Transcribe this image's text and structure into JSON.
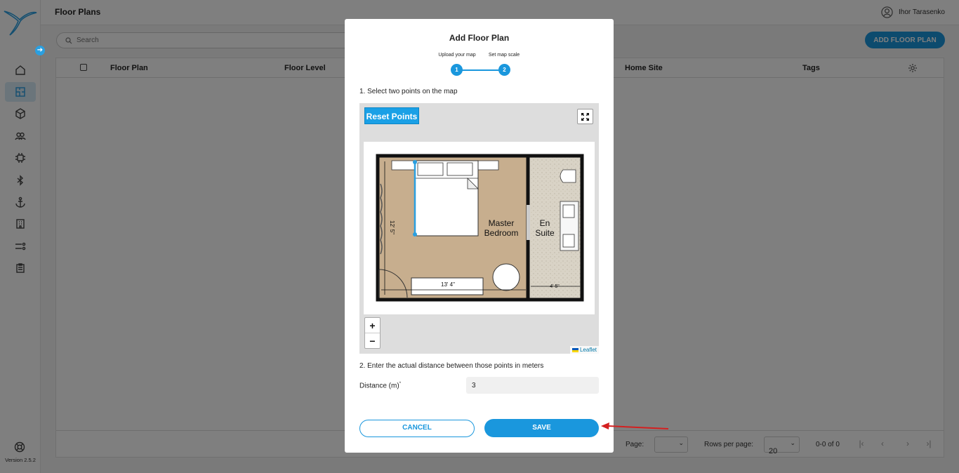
{
  "app": {
    "page_title": "Floor Plans",
    "user_name": "Ihor Tarasenko",
    "version": "Version 2.5.2",
    "accent_color": "#1a97dd"
  },
  "sidebar": {
    "items": [
      {
        "icon": "home-icon"
      },
      {
        "icon": "floor-plan-icon",
        "active": true
      },
      {
        "icon": "cube-icon"
      },
      {
        "icon": "users-icon"
      },
      {
        "icon": "chip-icon"
      },
      {
        "icon": "bluetooth-icon"
      },
      {
        "icon": "anchor-icon"
      },
      {
        "icon": "building-icon"
      },
      {
        "icon": "rules-icon"
      },
      {
        "icon": "report-icon"
      }
    ]
  },
  "toolbar": {
    "search_placeholder": "Search",
    "add_label": "ADD FLOOR PLAN"
  },
  "table": {
    "columns": [
      "Floor Plan",
      "Floor Level",
      "Home Site",
      "Tags"
    ],
    "footer": {
      "page_label": "Page:",
      "page_value": "",
      "rows_label": "Rows per page:",
      "rows_value": "20",
      "range": "0-0 of 0"
    }
  },
  "modal": {
    "title": "Add Floor Plan",
    "steps": [
      {
        "number": "1",
        "label": "Upload your map"
      },
      {
        "number": "2",
        "label": "Set map scale"
      }
    ],
    "instruction_1": "1. Select two points on the map",
    "instruction_2": "2. Enter the actual distance between those points in meters",
    "reset_label": "Reset Points",
    "zoom_in": "+",
    "zoom_out": "−",
    "attribution": "Leaflet",
    "distance_label": "Distance (m)",
    "distance_required_mark": "*",
    "distance_value": "3",
    "cancel_label": "CANCEL",
    "save_label": "SAVE"
  },
  "floorplan": {
    "room_1_line_1": "Master",
    "room_1_line_2": "Bedroom",
    "room_2_line_1": "En",
    "room_2_line_2": "Suite",
    "dim_height": "12' 5\"",
    "dim_width": "13' 4\"",
    "dim_suite": "4' 5\""
  }
}
